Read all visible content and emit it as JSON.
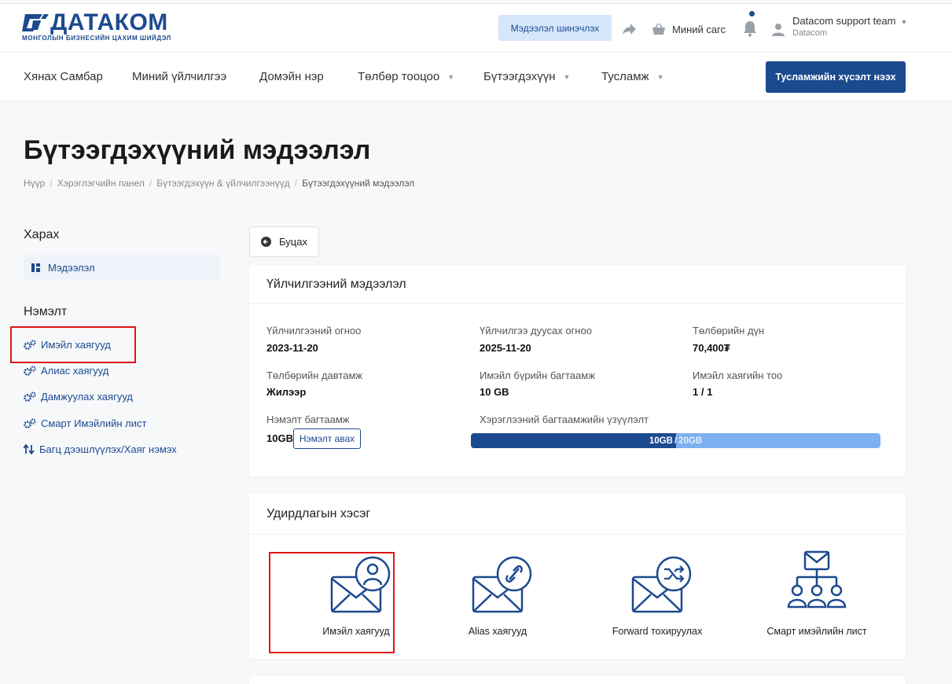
{
  "header": {
    "logo_text": "ДАТАКОМ",
    "logo_subtitle": "МОНГОЛЫН БИЗНЕСИЙН ЦАХИМ ШИЙДЭЛ",
    "update_button": "Мэдээлэл шинэчлэх",
    "cart_label": "Миний сагс",
    "user_name": "Datacom support team",
    "user_org": "Datacom"
  },
  "nav": {
    "items": [
      {
        "label": "Хянах Самбар",
        "has_caret": false
      },
      {
        "label": "Миний үйлчилгээ",
        "has_caret": false
      },
      {
        "label": "Домэйн нэр",
        "has_caret": false
      },
      {
        "label": "Төлбөр тооцоо",
        "has_caret": true
      },
      {
        "label": "Бүтээгдэхүүн",
        "has_caret": true
      },
      {
        "label": "Тусламж",
        "has_caret": true
      }
    ],
    "support_button": "Тусламжийн хүсэлт нээх"
  },
  "page": {
    "title": "Бүтээгдэхүүний мэдээлэл",
    "breadcrumb": [
      "Нүүр",
      "Хэрэглэгчийн панел",
      "Бүтээгдэхүүн & үйлчилгээнүүд",
      "Бүтээгдэхүүний мэдээлэл"
    ]
  },
  "sidebar": {
    "view_heading": "Харах",
    "view_item": "Мэдээлэл",
    "extra_heading": "Нэмэлт",
    "extra_items": [
      {
        "label": "Имэйл хаягууд",
        "icon": "gears-icon"
      },
      {
        "label": "Алиас хаягууд",
        "icon": "gears-icon"
      },
      {
        "label": "Дамжуулах хаягууд",
        "icon": "gears-icon"
      },
      {
        "label": "Смарт Имэйлийн лист",
        "icon": "gears-icon"
      },
      {
        "label": "Багц дээшлүүлэх/Хаяг нэмэх",
        "icon": "sort-arrows-icon"
      }
    ]
  },
  "back_button": "Буцах",
  "service_info": {
    "heading": "Үйлчилгээний мэдээлэл",
    "fields": [
      {
        "label": "Үйлчилгээний огноо",
        "value": "2023-11-20"
      },
      {
        "label": "Үйлчилгээ дуусах огноо",
        "value": "2025-11-20"
      },
      {
        "label": "Төлбөрийн дүн",
        "value": "70,400₮"
      },
      {
        "label": "Төлбөрийн давтамж",
        "value": "Жилээр"
      },
      {
        "label": "Имэйл бүрийн багтаамж",
        "value": "10 GB"
      },
      {
        "label": "Имэйл хаягийн тоо",
        "value": "1 / 1"
      }
    ],
    "extra_capacity_label": "Нэмэлт багтаамж",
    "extra_capacity_value": "10GB",
    "extra_capacity_button": "Нэмэлт авах",
    "usage_label": "Хэрэглээний багтаамжийн үзүүлэлт",
    "usage_used": "10GB",
    "usage_total": "20GB",
    "usage_fraction": 0.5
  },
  "management": {
    "heading": "Удирдлагын хэсэг",
    "tools": [
      {
        "label": "Имэйл хаягууд",
        "icon": "email-user-icon"
      },
      {
        "label": "Alias хаягууд",
        "icon": "email-link-icon"
      },
      {
        "label": "Forward тохируулах",
        "icon": "email-forward-icon"
      },
      {
        "label": "Смарт имэйлийн лист",
        "icon": "email-group-icon"
      }
    ]
  },
  "colors": {
    "brand": "#1c4a8f",
    "progress_bg": "#7db0f0",
    "highlight": "#e01515"
  }
}
